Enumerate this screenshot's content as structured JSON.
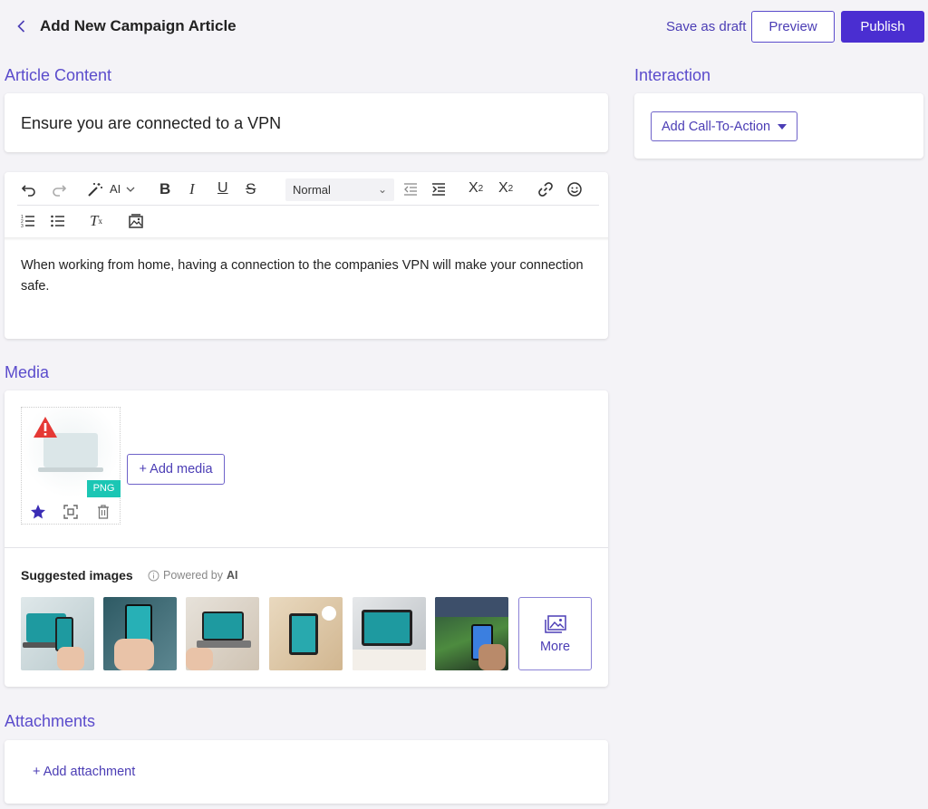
{
  "header": {
    "title": "Add New Campaign Article",
    "save_draft_label": "Save as draft",
    "preview_label": "Preview",
    "publish_label": "Publish"
  },
  "sections": {
    "article_content": "Article Content",
    "media": "Media",
    "attachments": "Attachments",
    "interaction": "Interaction"
  },
  "article": {
    "title": "Ensure you are connected to a VPN",
    "body": "When working from home, having a connection to the companies VPN will make your connection safe."
  },
  "toolbar": {
    "ai_label": "AI",
    "format_select": "Normal"
  },
  "media": {
    "file_type_badge": "PNG",
    "add_media_label": "+ Add media",
    "suggested_label": "Suggested images",
    "powered_by": "Powered by",
    "powered_ai": "AI",
    "more_label": "More",
    "suggested_images": [
      "vpn-laptop-phone",
      "vpn-phone-hand",
      "vpn-laptop-desk",
      "vpn-phone-lock",
      "vpn-tablet",
      "vpn-phone-stadium"
    ]
  },
  "attachments": {
    "add_label": "+ Add attachment"
  },
  "interaction": {
    "cta_label": "Add Call-To-Action"
  },
  "colors": {
    "accent": "#4a2ed1",
    "accent_text": "#4b3db5",
    "section_label": "#5b4ccc",
    "png_badge": "#1bc6b4",
    "warning": "#e53935",
    "background": "#f4f3f7"
  }
}
